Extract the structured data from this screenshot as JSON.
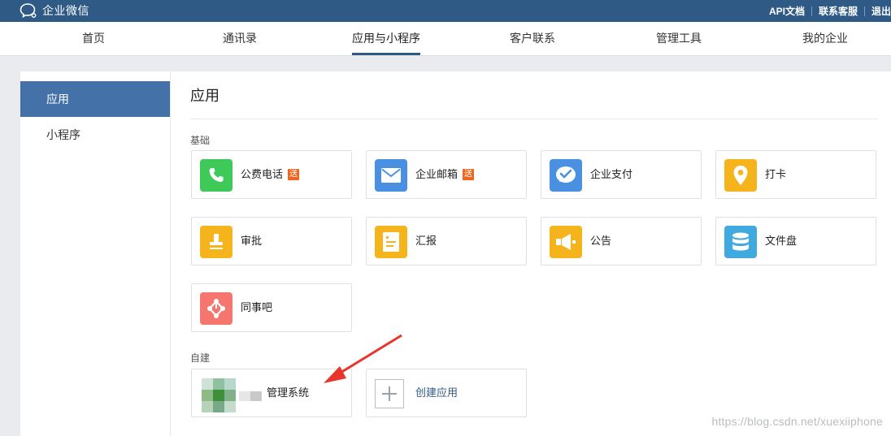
{
  "topbar": {
    "brand": "企业微信",
    "links": [
      "API文档",
      "联系客服",
      "退出"
    ]
  },
  "nav": {
    "tabs": [
      "首页",
      "通讯录",
      "应用与小程序",
      "客户联系",
      "管理工具",
      "我的企业"
    ],
    "active": "应用与小程序"
  },
  "sidebar": {
    "items": [
      "应用",
      "小程序"
    ],
    "active": "应用"
  },
  "main": {
    "title": "应用",
    "basic_label": "基础",
    "custom_label": "自建",
    "basic_apps": [
      {
        "name": "公费电话",
        "badge": "送",
        "icon": "phone-icon",
        "color": "#3ec959"
      },
      {
        "name": "企业邮箱",
        "badge": "送",
        "icon": "mail-icon",
        "color": "#4a90e2"
      },
      {
        "name": "企业支付",
        "badge": "",
        "icon": "pay-icon",
        "color": "#4a90e2"
      },
      {
        "name": "打卡",
        "badge": "",
        "icon": "location-pin-icon",
        "color": "#f5b31c"
      },
      {
        "name": "审批",
        "badge": "",
        "icon": "stamp-icon",
        "color": "#f5b31c"
      },
      {
        "name": "汇报",
        "badge": "",
        "icon": "report-icon",
        "color": "#f5b31c"
      },
      {
        "name": "公告",
        "badge": "",
        "icon": "megaphone-icon",
        "color": "#f5b31c"
      },
      {
        "name": "文件盘",
        "badge": "",
        "icon": "database-icon",
        "color": "#3fa9e0"
      },
      {
        "name": "同事吧",
        "badge": "",
        "icon": "share-nodes-icon",
        "color": "#f4766f"
      }
    ],
    "custom_apps": [
      {
        "name": "管理系统",
        "icon": "blurred-app-icon"
      },
      {
        "name": "创建应用",
        "icon": "plus-icon"
      }
    ]
  },
  "watermark": "https://blog.csdn.net/xuexiiphone"
}
